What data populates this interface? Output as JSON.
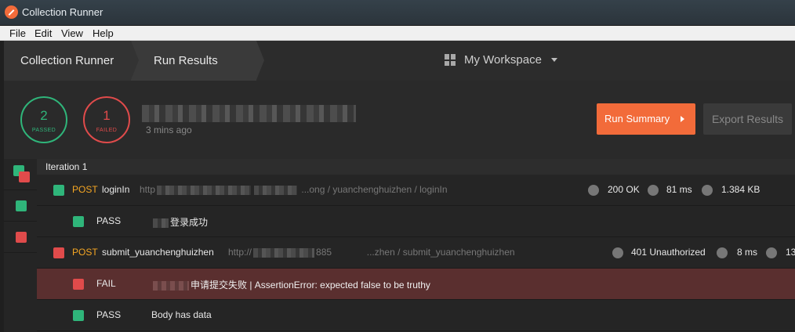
{
  "window": {
    "title": "Collection Runner"
  },
  "menubar": {
    "items": [
      "File",
      "Edit",
      "View",
      "Help"
    ]
  },
  "header": {
    "breadcrumb": [
      "Collection Runner",
      "Run Results"
    ],
    "workspace": "My Workspace"
  },
  "summary": {
    "passed_count": "2",
    "passed_label": "PASSED",
    "failed_count": "1",
    "failed_label": "FAILED",
    "run_time": "3 mins ago",
    "run_summary_button": "Run Summary",
    "export_button": "Export Results"
  },
  "iteration": {
    "label": "Iteration 1"
  },
  "requests": [
    {
      "method": "POST",
      "name": "loginIn",
      "url_prefix": "http",
      "url_suffix": "...ong / yuanchenghuizhen / loginIn",
      "status": "200 OK",
      "time": "81 ms",
      "size": "1.384 KB",
      "result": "pass",
      "tests": [
        {
          "result": "PASS",
          "text": "登录成功"
        }
      ]
    },
    {
      "method": "POST",
      "name": "submit_yuanchenghuizhen",
      "url_prefix": "http://",
      "url_mid": "885",
      "url_suffix": "...zhen / submit_yuanchenghuizhen",
      "status": "401 Unauthorized",
      "time": "8 ms",
      "size": "13",
      "result": "fail",
      "tests": [
        {
          "result": "FAIL",
          "text": "申请提交失败 | AssertionError: expected false to be truthy"
        },
        {
          "result": "PASS",
          "text": "Body has data"
        }
      ]
    }
  ],
  "colors": {
    "accent": "#f26b3a",
    "pass": "#2fb57a",
    "fail": "#e04b4b",
    "method": "#f5a623"
  }
}
